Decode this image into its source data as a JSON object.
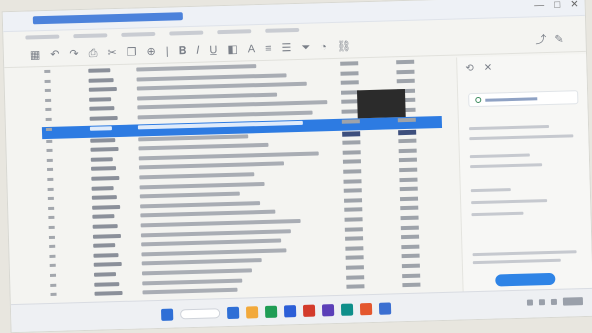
{
  "window": {
    "title": "",
    "controls": [
      "—",
      "□",
      "✕"
    ]
  },
  "menu": {
    "items": [
      "",
      "",
      "",
      "",
      "",
      ""
    ]
  },
  "toolbar": {
    "left_icons": [
      "grid-icon",
      "undo-icon",
      "redo-icon",
      "print-icon",
      "cut-icon",
      "copy-icon"
    ],
    "zoom": "",
    "right_icons": [
      "share-icon",
      "comment-icon"
    ],
    "user": ""
  },
  "table": {
    "row_count": 24,
    "selected_row": 6,
    "bold_row": 7
  },
  "side_panel": {
    "header_icons": [
      "history-icon",
      "close-icon"
    ],
    "action_button": ""
  },
  "taskbar": {
    "apps": [
      "#2f6fd6",
      "#f2a93b",
      "#1f9d55",
      "#2b5ed7",
      "#d33b2c",
      "#5b3fb8",
      "#0f8f8a",
      "#e4572e",
      "#3b6fd1"
    ],
    "time": ""
  },
  "colors": {
    "selection": "#2d7be2",
    "accent": "#2f84e6",
    "titlebar": "#2f6fd6"
  }
}
